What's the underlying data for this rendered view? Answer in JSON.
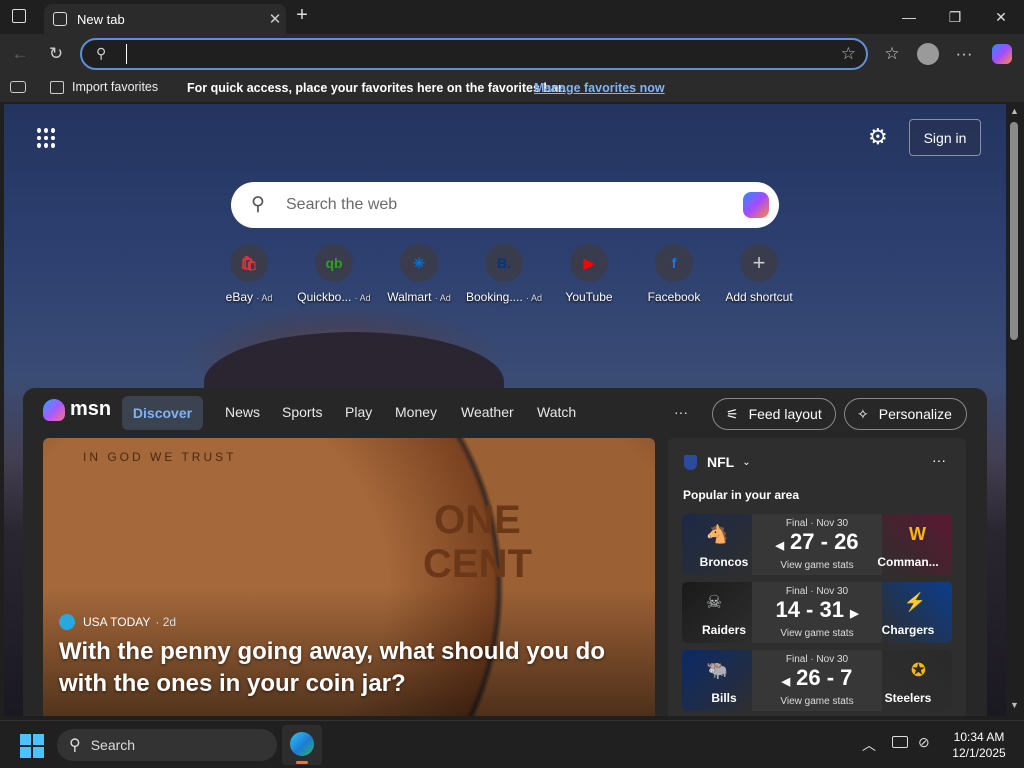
{
  "tab": {
    "title": "New tab"
  },
  "address": {
    "value": "",
    "placeholder": ""
  },
  "favbar": {
    "import_label": "Import favorites",
    "message": "For quick access, place your favorites here on the favorites bar.",
    "manage_link": "Manage favorites now"
  },
  "newtab": {
    "sign_in": "Sign in",
    "search_placeholder": "Search the web",
    "shortcuts": [
      {
        "label": "eBay",
        "ad": "· Ad",
        "glyph": "🛍",
        "color": "#e53238"
      },
      {
        "label": "Quickbo...",
        "ad": "· Ad",
        "glyph": "qb",
        "color": "#2ca01c"
      },
      {
        "label": "Walmart",
        "ad": "· Ad",
        "glyph": "✳",
        "color": "#0071dc"
      },
      {
        "label": "Booking....",
        "ad": "· Ad",
        "glyph": "B.",
        "color": "#003580"
      },
      {
        "label": "YouTube",
        "ad": "",
        "glyph": "▶",
        "color": "#ff0000"
      },
      {
        "label": "Facebook",
        "ad": "",
        "glyph": "f",
        "color": "#1877f2"
      },
      {
        "label": "Add shortcut",
        "ad": "",
        "glyph": "+",
        "color": "#555555"
      }
    ]
  },
  "msn": {
    "brand": "msn",
    "nav": [
      "Discover",
      "News",
      "Sports",
      "Play",
      "Money",
      "Weather",
      "Watch"
    ],
    "more": "···",
    "feed_layout": "Feed layout",
    "personalize": "Personalize",
    "hero": {
      "source": "USA TODAY",
      "age": "· 2d",
      "headline": "With the penny going away, what should you do with the ones in your coin jar?"
    },
    "nfl": {
      "title": "NFL",
      "subtitle": "Popular in your area",
      "games": [
        {
          "status": "Final · Nov 30",
          "score": "27 - 26",
          "view": "View game stats",
          "team1": "Broncos",
          "team2": "Comman...",
          "arrow": "left",
          "color1": "#fb4f14",
          "color2": "#8b1c2c"
        },
        {
          "status": "Final · Nov 30",
          "score": "14 - 31",
          "view": "View game stats",
          "team1": "Raiders",
          "team2": "Chargers",
          "arrow": "right",
          "color1": "#a5acaf",
          "color2": "#0080c6"
        },
        {
          "status": "Final · Nov 30",
          "score": "26 - 7",
          "view": "View game stats",
          "team1": "Bills",
          "team2": "Steelers",
          "arrow": "left",
          "color1": "#00338d",
          "color2": "#ffb612"
        }
      ]
    }
  },
  "taskbar": {
    "search": "Search",
    "time": "10:34 AM",
    "date": "12/1/2025"
  }
}
